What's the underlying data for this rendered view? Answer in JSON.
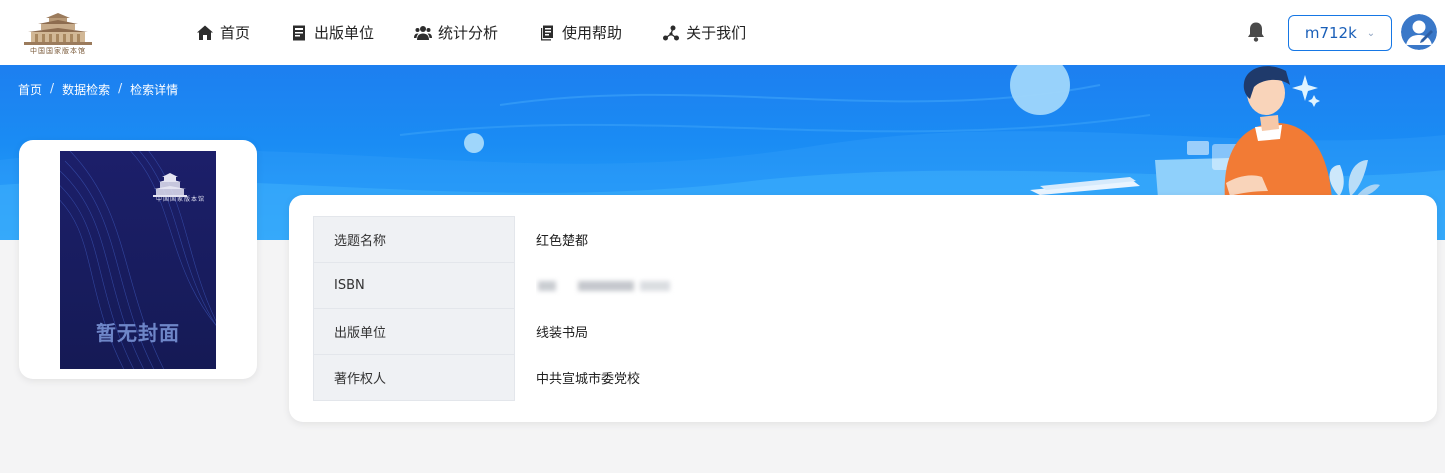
{
  "logo": {
    "caption": "中国国家版本馆"
  },
  "nav": {
    "items": [
      {
        "label": "首页",
        "icon": "home-icon"
      },
      {
        "label": "出版单位",
        "icon": "book-icon"
      },
      {
        "label": "统计分析",
        "icon": "users-icon"
      },
      {
        "label": "使用帮助",
        "icon": "document-icon"
      },
      {
        "label": "关于我们",
        "icon": "nodes-icon"
      }
    ]
  },
  "header": {
    "username": "m712k",
    "user_chevron": "⌄"
  },
  "breadcrumb": {
    "items": [
      "首页",
      "数据检索",
      "检索详情"
    ],
    "separator": "/"
  },
  "cover": {
    "placeholder_text": "暂无封面",
    "logo_caption": "中国国家版本馆"
  },
  "details": {
    "rows": [
      {
        "key": "选题名称",
        "value": "红色楚都"
      },
      {
        "key": "ISBN",
        "value": "",
        "redacted": true
      },
      {
        "key": "出版单位",
        "value": "线装书局"
      },
      {
        "key": "著作权人",
        "value": "中共宣城市委党校"
      }
    ]
  },
  "colors": {
    "accent": "#1677e5",
    "banner": "#1a8cf4",
    "illustration_shirt": "#f27b35"
  }
}
